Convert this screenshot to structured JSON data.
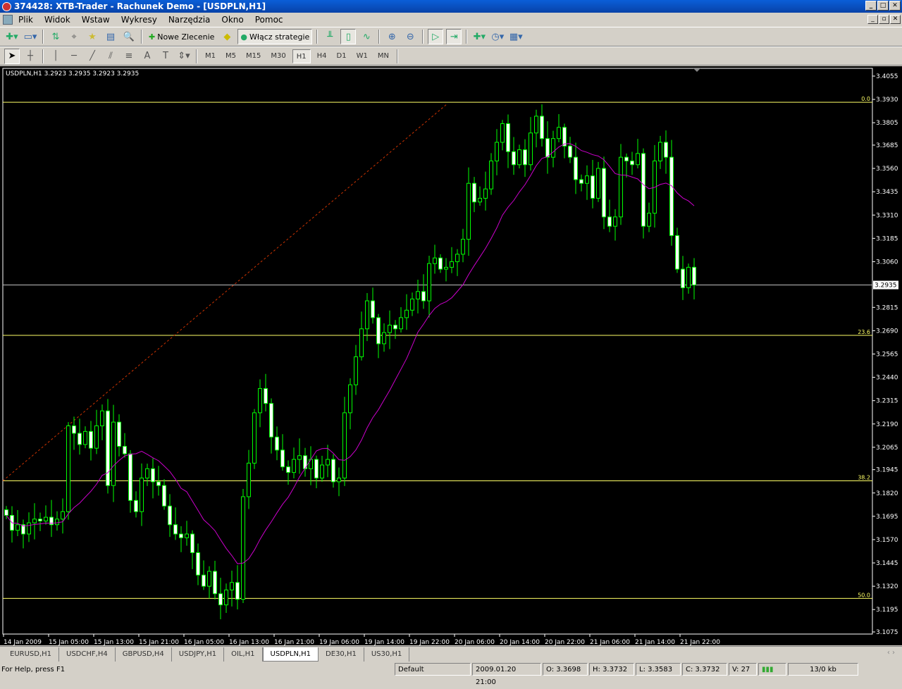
{
  "window": {
    "title": "374428: XTB-Trader - Rachunek Demo - [USDPLN,H1]"
  },
  "menu": [
    "Plik",
    "Widok",
    "Wstaw",
    "Wykresy",
    "Narzędzia",
    "Okno",
    "Pomoc"
  ],
  "toolbar": {
    "new_order": "Nowe Zlecenie",
    "strategies": "Włącz strategie"
  },
  "timeframes": [
    "M1",
    "M5",
    "M15",
    "M30",
    "H1",
    "H4",
    "D1",
    "W1",
    "MN"
  ],
  "active_timeframe": "H1",
  "chart_info": "USDPLN,H1  3.2923 3.2935 3.2923 3.2935",
  "tabs": [
    "EURUSD,H1",
    "USDCHF,H4",
    "GBPUSD,H4",
    "USDJPY,H1",
    "OIL,H1",
    "USDPLN,H1",
    "DE30,H1",
    "US30,H1"
  ],
  "active_tab": "USDPLN,H1",
  "status": {
    "help": "For Help, press F1",
    "profile": "Default",
    "time": "2009.01.20 21:00",
    "open": "O: 3.3698",
    "high": "H: 3.3732",
    "low": "L: 3.3583",
    "close": "C: 3.3732",
    "volume": "V: 27",
    "traffic": "13/0 kb"
  },
  "chart_data": {
    "type": "candlestick",
    "symbol": "USDPLN",
    "timeframe": "H1",
    "colors": {
      "background": "#000000",
      "candle": "#00ff00",
      "bull_body": "#000000",
      "bear_body": "#ffffff",
      "ma": "#cc00cc",
      "fib": "#ffff66",
      "trend": "#cc3300",
      "bid": "#c0c0c0"
    },
    "price_ticks": [
      "3.4055",
      "3.3930",
      "3.3805",
      "3.3685",
      "3.3560",
      "3.3435",
      "3.3310",
      "3.3185",
      "3.3060",
      "3.2815",
      "3.2690",
      "3.2565",
      "3.2440",
      "3.2315",
      "3.2190",
      "3.2065",
      "3.1945",
      "3.1820",
      "3.1695",
      "3.1570",
      "3.1445",
      "3.1320",
      "3.1195",
      "3.1075"
    ],
    "ylim": [
      3.1075,
      3.4055
    ],
    "current_price": "3.2935",
    "time_labels": [
      "14 Jan 2009",
      "15 Jan 05:00",
      "15 Jan 13:00",
      "15 Jan 21:00",
      "16 Jan 05:00",
      "16 Jan 13:00",
      "16 Jan 21:00",
      "19 Jan 06:00",
      "19 Jan 14:00",
      "19 Jan 22:00",
      "20 Jan 06:00",
      "20 Jan 14:00",
      "20 Jan 22:00",
      "21 Jan 06:00",
      "21 Jan 14:00",
      "21 Jan 22:00"
    ],
    "fibo": [
      {
        "label": "0.0",
        "price": 3.3915
      },
      {
        "label": "23.6",
        "price": 3.2665
      },
      {
        "label": "38.2",
        "price": 3.1885
      },
      {
        "label": "50.0",
        "price": 3.1255
      }
    ],
    "moving_average_period": 14,
    "closes": [
      3.17,
      3.162,
      3.165,
      3.16,
      3.166,
      3.168,
      3.167,
      3.169,
      3.165,
      3.168,
      3.172,
      3.218,
      3.214,
      3.208,
      3.215,
      3.206,
      3.218,
      3.226,
      3.186,
      3.22,
      3.207,
      3.203,
      3.178,
      3.172,
      3.19,
      3.195,
      3.188,
      3.186,
      3.175,
      3.165,
      3.16,
      3.158,
      3.16,
      3.15,
      3.138,
      3.132,
      3.14,
      3.128,
      3.122,
      3.13,
      3.134,
      3.125,
      3.18,
      3.198,
      3.225,
      3.238,
      3.23,
      3.212,
      3.205,
      3.196,
      3.193,
      3.2,
      3.202,
      3.195,
      3.2,
      3.19,
      3.197,
      3.2,
      3.188,
      3.19,
      3.225,
      3.24,
      3.255,
      3.27,
      3.285,
      3.276,
      3.262,
      3.268,
      3.272,
      3.27,
      3.276,
      3.28,
      3.286,
      3.29,
      3.285,
      3.305,
      3.308,
      3.302,
      3.303,
      3.306,
      3.31,
      3.318,
      3.348,
      3.338,
      3.34,
      3.345,
      3.36,
      3.37,
      3.38,
      3.365,
      3.358,
      3.366,
      3.358,
      3.375,
      3.384,
      3.372,
      3.362,
      3.372,
      3.378,
      3.368,
      3.362,
      3.35,
      3.348,
      3.352,
      3.34,
      3.356,
      3.33,
      3.325,
      3.33,
      3.362,
      3.36,
      3.358,
      3.364,
      3.325,
      3.332,
      3.36,
      3.37,
      3.362,
      3.32,
      3.302,
      3.292,
      3.303,
      3.2935
    ]
  }
}
